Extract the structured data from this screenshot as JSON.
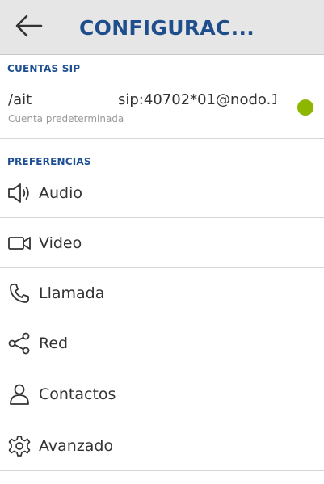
{
  "header": {
    "title": "CONFIGURAC...",
    "back_icon": "arrow-left-icon"
  },
  "sections": {
    "sip_accounts_title": "CUENTAS SIP",
    "preferences_title": "PREFERENCIAS"
  },
  "account": {
    "name": "/ait",
    "uri": "sip:40702*01@nodo.1",
    "subtitle": "Cuenta predeterminada",
    "status_color": "#8db600"
  },
  "preferences": [
    {
      "label": "Audio",
      "icon": "speaker-icon"
    },
    {
      "label": "Video",
      "icon": "video-camera-icon"
    },
    {
      "label": "Llamada",
      "icon": "phone-icon"
    },
    {
      "label": "Red",
      "icon": "share-network-icon"
    },
    {
      "label": "Contactos",
      "icon": "user-icon"
    },
    {
      "label": "Avanzado",
      "icon": "gear-icon"
    }
  ],
  "colors": {
    "accent": "#1e4e8c",
    "header_bg": "#e6e6e6",
    "divider": "#d6d6d6"
  }
}
